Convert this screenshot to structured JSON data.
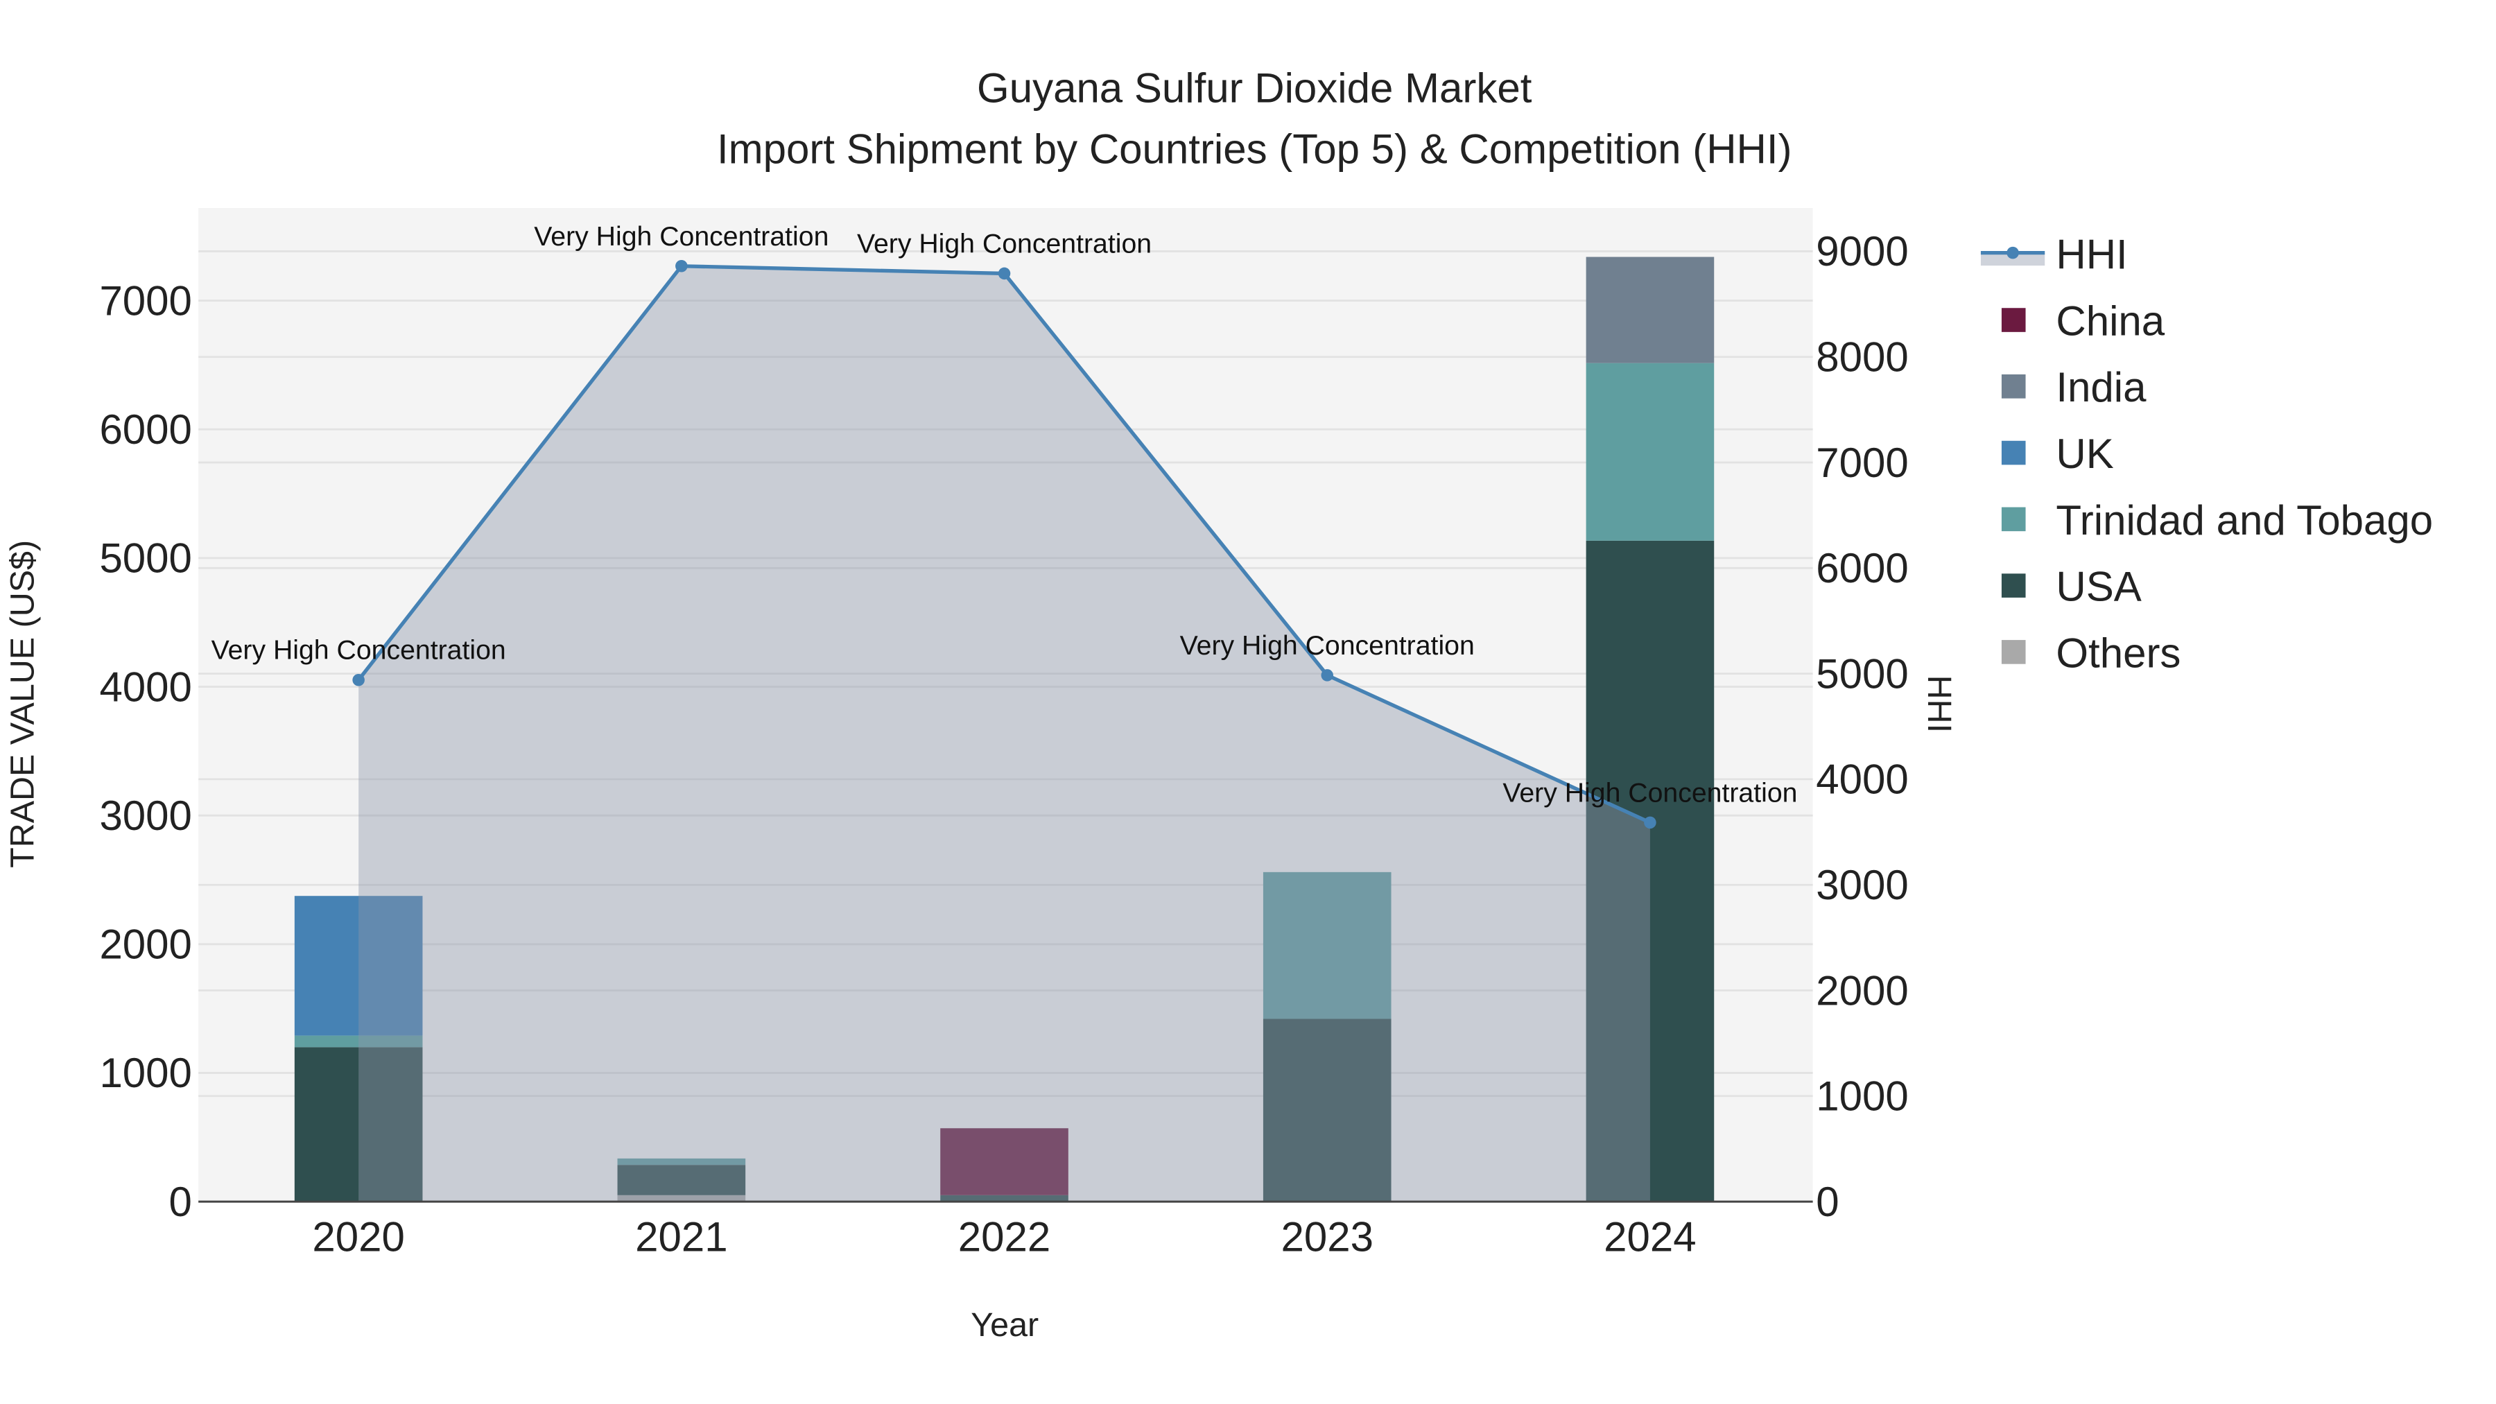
{
  "chart_data": {
    "type": "bar",
    "title": "Guyana Sulfur Dioxide Market",
    "subtitle": "Import Shipment by Countries (Top 5) & Competition (HHI)",
    "xlabel": "Year",
    "ylabel": "TRADE VALUE (US$)",
    "y2label": "HHI",
    "categories": [
      "2020",
      "2021",
      "2022",
      "2023",
      "2024"
    ],
    "ylim": [
      0,
      7720
    ],
    "y2lim": [
      0,
      9410
    ],
    "yticks": [
      0,
      1000,
      2000,
      3000,
      4000,
      5000,
      6000,
      7000
    ],
    "y2ticks": [
      0,
      1000,
      2000,
      3000,
      4000,
      5000,
      6000,
      7000,
      8000,
      9000
    ],
    "grid": true,
    "legend_position": "right",
    "series": [
      {
        "name": "Others",
        "color": "#a9a9a9",
        "values": [
          0,
          50,
          0,
          0,
          0
        ]
      },
      {
        "name": "USA",
        "color": "#2f4f4f",
        "values": [
          1200,
          235,
          50,
          1420,
          5135
        ]
      },
      {
        "name": "Trinidad and Tobago",
        "color": "#5f9ea0",
        "values": [
          90,
          50,
          0,
          1140,
          1380
        ]
      },
      {
        "name": "UK",
        "color": "#4682b4",
        "values": [
          1085,
          0,
          0,
          0,
          0
        ]
      },
      {
        "name": "India",
        "color": "#708090",
        "values": [
          0,
          0,
          0,
          0,
          825
        ]
      },
      {
        "name": "China",
        "color": "#6b1a40",
        "values": [
          0,
          0,
          520,
          0,
          0
        ]
      }
    ],
    "hhi": {
      "name": "HHI",
      "color": "#4682b4",
      "values": [
        4940,
        8860,
        8790,
        4985,
        3590
      ],
      "labels": [
        "Very High Concentration",
        "Very High Concentration",
        "Very High Concentration",
        "Very High Concentration",
        "Very High Concentration"
      ]
    },
    "legend": [
      "HHI",
      "China",
      "India",
      "UK",
      "Trinidad and Tobago",
      "USA",
      "Others"
    ]
  }
}
